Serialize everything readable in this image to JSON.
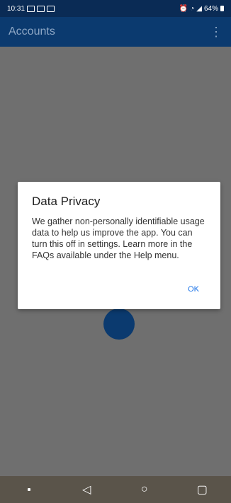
{
  "status_bar": {
    "time": "10:31",
    "battery": "64%"
  },
  "app_bar": {
    "title": "Accounts",
    "overflow_icon": "⋮"
  },
  "dialog": {
    "title": "Data Privacy",
    "body": "We gather non-personally identifiable usage data to help us improve the app. You can turn this off in settings. Learn more in the FAQs available under the Help menu.",
    "ok_label": "OK"
  },
  "nav_bar": {
    "back_icon": "◁",
    "home_icon": "○",
    "recents_icon": "▢"
  }
}
